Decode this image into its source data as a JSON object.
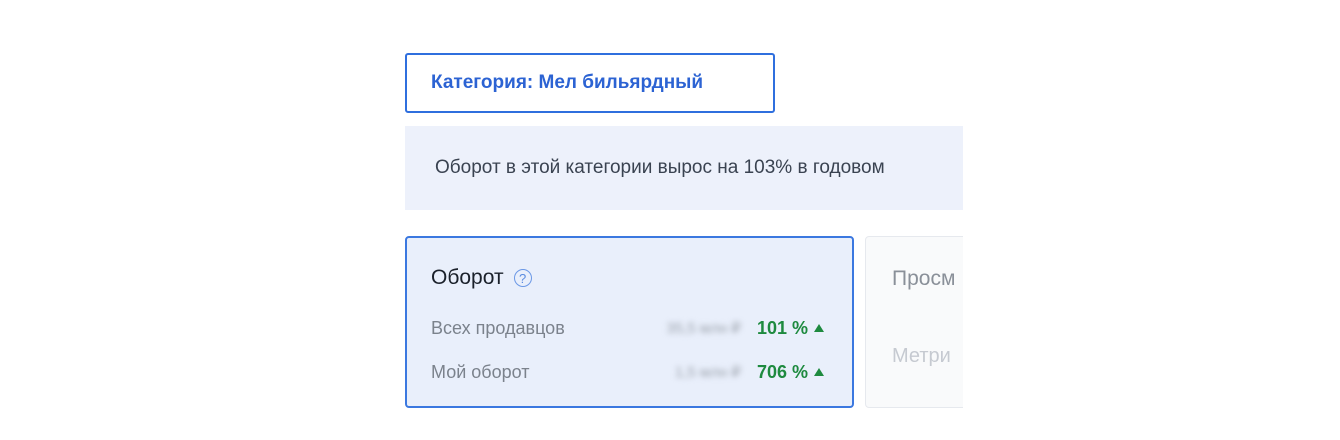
{
  "category_tab": {
    "label": "Категория: Мел бильярдный"
  },
  "banner": {
    "text": "Оборот в этой категории вырос на 103% в годовом"
  },
  "cards": [
    {
      "title": "Оборот",
      "rows": [
        {
          "label": "Всех продавцов",
          "value_blurred": "35,5 млн ₽",
          "percent": "101 %"
        },
        {
          "label": "Мой оборот",
          "value_blurred": "1,5 млн ₽",
          "percent": "706 %"
        }
      ]
    },
    {
      "title": "Просм",
      "sub": "Метри"
    }
  ],
  "icons": {
    "help": "question-circle-icon",
    "trend": "triangle-up-icon"
  },
  "colors": {
    "accent": "#2f6fde",
    "positive": "#1e8a3f",
    "banner_bg": "#edf1fb",
    "card_bg": "#e9effb"
  }
}
